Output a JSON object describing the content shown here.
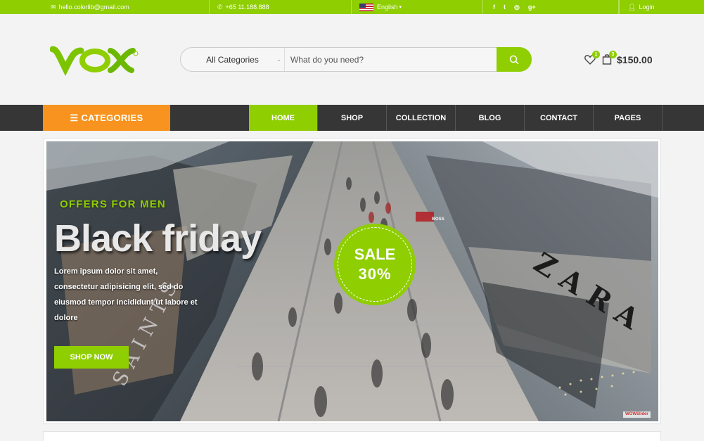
{
  "topbar": {
    "email": "hello.colorlib@gmail.com",
    "phone": "+65 11.188.888",
    "language": "English",
    "social": [
      {
        "name": "facebook-icon",
        "glyph": "f"
      },
      {
        "name": "twitter-icon",
        "glyph": "t"
      },
      {
        "name": "instagram-icon",
        "glyph": "◎"
      },
      {
        "name": "google-plus-icon",
        "glyph": "g+"
      }
    ],
    "login": "Login"
  },
  "header": {
    "logo_text": "VOX",
    "search": {
      "category": "All Categories",
      "placeholder": "What do you need?"
    },
    "wishlist_count": "1",
    "cart_count": "3",
    "cart_total": "$150.00"
  },
  "nav": {
    "categories_label": "CATEGORIES",
    "items": [
      {
        "label": "HOME",
        "active": true
      },
      {
        "label": "SHOP",
        "active": false
      },
      {
        "label": "COLLECTION",
        "active": false
      },
      {
        "label": "BLOG",
        "active": false
      },
      {
        "label": "CONTACT",
        "active": false
      },
      {
        "label": "PAGES",
        "active": false
      }
    ]
  },
  "hero": {
    "offers": "OFFERS FOR MEN",
    "headline": "Black friday",
    "description": "Lorem ipsum dolor sit amet, consectetur adipisicing elit, sed do eiusmod tempor incididunt ut labore et dolore",
    "button": "SHOP NOW",
    "sale_line1": "SALE",
    "sale_line2": "30%",
    "store_sign": "ZARA",
    "store_sign_left": "SAINTS",
    "store_sign_small": "BOSS",
    "watermark": "WOWSlider"
  },
  "colors": {
    "accent": "#8fce00",
    "orange": "#f7931e",
    "nav_bg": "#363636"
  }
}
